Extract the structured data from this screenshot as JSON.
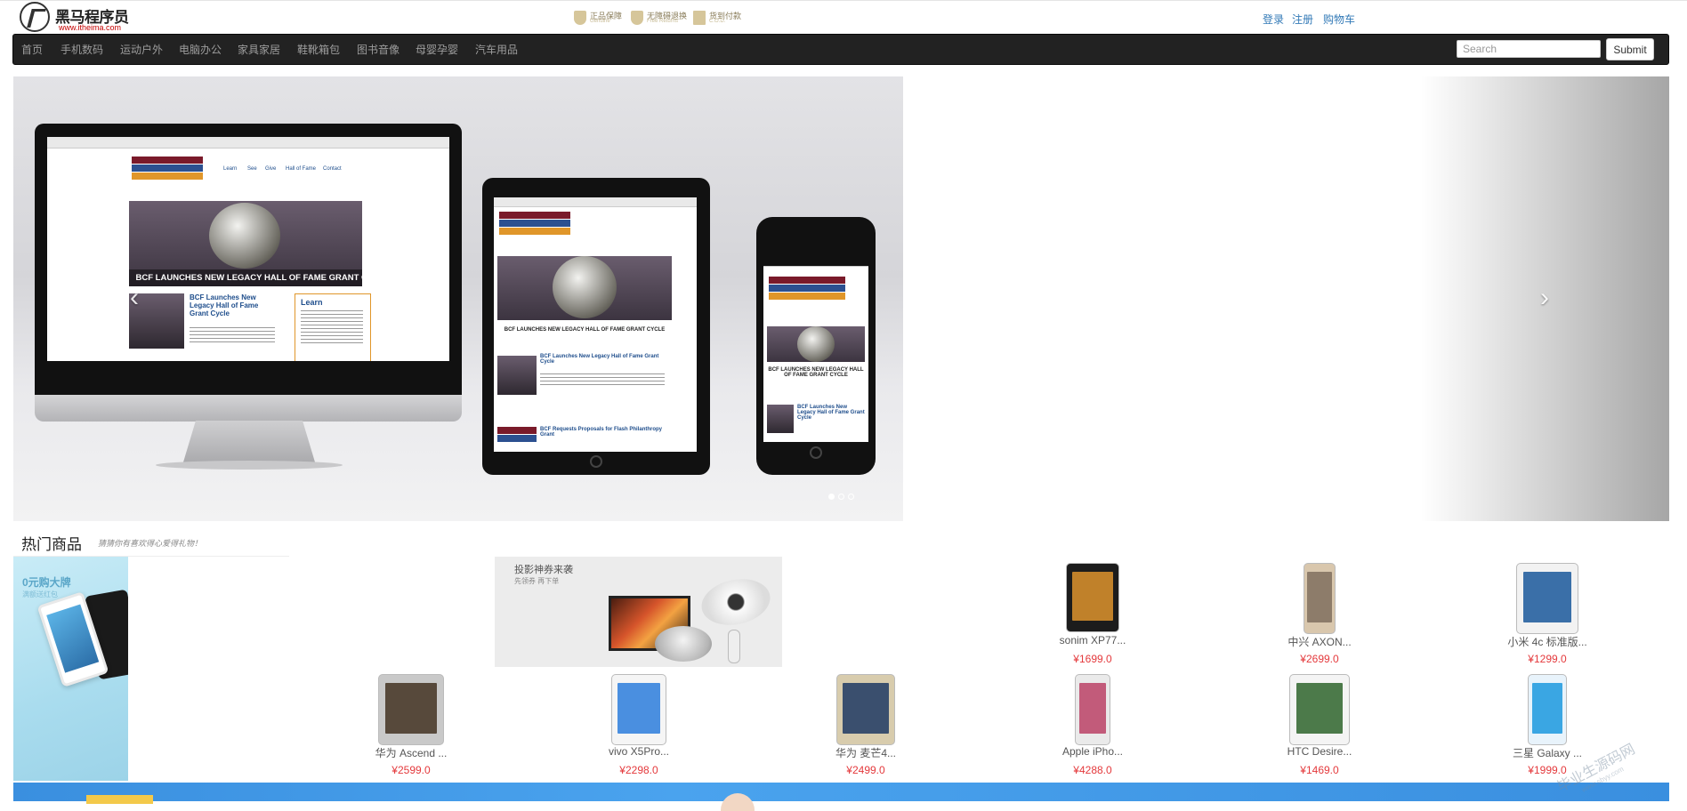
{
  "header": {
    "logo_title": "黑马程序员",
    "logo_url": "www.itheima.com",
    "badges": [
      {
        "title": "正品保障",
        "sub": "Genuine"
      },
      {
        "title": "无障碍退换",
        "sub": "Free Returns"
      },
      {
        "title": "货到付款",
        "sub": "C.O.D."
      }
    ],
    "user_links": [
      "登录",
      "注册",
      "购物车"
    ]
  },
  "navbar": {
    "items": [
      "首页",
      "手机数码",
      "运动户外",
      "电脑办公",
      "家具家居",
      "鞋靴箱包",
      "图书音像",
      "母婴孕婴",
      "汽车用品"
    ],
    "search_placeholder": "Search",
    "submit_label": "Submit"
  },
  "carousel": {
    "prev_icon": "‹",
    "next_icon": "›",
    "indicator_count": 3,
    "active_index": 0,
    "slide_text": {
      "desktop_headline": "BCF LAUNCHES NEW LEGACY HALL OF FAME GRANT CYCLE",
      "desktop_article": "BCF Launches New Legacy Hall of Fame Grant Cycle",
      "desktop_learn": "Learn",
      "desktop_nav": [
        "Learn",
        "See",
        "Give",
        "Hall of Fame",
        "Contact"
      ],
      "tablet_headline": "BCF LAUNCHES NEW LEGACY HALL OF FAME GRANT CYCLE",
      "tablet_article": "BCF Launches New Legacy Hall of Fame Grant Cycle",
      "tablet_article2": "BCF Requests Proposals for Flash Philanthropy Grant",
      "phone_headline": "BCF LAUNCHES NEW LEGACY HALL OF FAME GRANT CYCLE",
      "phone_article": "BCF Launches New Legacy Hall of Fame Grant Cycle"
    }
  },
  "hot": {
    "title": "热门商品",
    "subtitle": "猜猜你有喜欢得心爱得礼物！",
    "promo_left_title": "0元购大牌",
    "promo_left_sub": "满额送红包",
    "promo_mid_title": "投影神券来袭",
    "promo_mid_sub": "先领券 再下单"
  },
  "products": [
    {
      "name": "sonim XP77...",
      "price": "¥1699.0",
      "body": "#1c1c1c",
      "screen": "#c0812a"
    },
    {
      "name": "中兴 AXON...",
      "price": "¥2699.0",
      "body": "#d9c7ad",
      "screen": "#8d7c6a"
    },
    {
      "name": "小米 4c 标准版...",
      "price": "¥1299.0",
      "body": "#f2f2f2",
      "screen": "#3a6fa8"
    },
    {
      "name": "华为 Ascend ...",
      "price": "¥2599.0",
      "body": "#c9c9c9",
      "screen": "#57493b"
    },
    {
      "name": "vivo X5Pro...",
      "price": "¥2298.0",
      "body": "#f5f5f5",
      "screen": "#4a8fe0"
    },
    {
      "name": "华为 麦芒4...",
      "price": "¥2499.0",
      "body": "#d8ccad",
      "screen": "#3a4f6e"
    },
    {
      "name": "Apple iPho...",
      "price": "¥4288.0",
      "body": "#eaeaea",
      "screen": "#c25b7a"
    },
    {
      "name": "HTC Desire...",
      "price": "¥1469.0",
      "body": "#f4f4f4",
      "screen": "#4c7a4a"
    },
    {
      "name": "三星 Galaxy ...",
      "price": "¥1999.0",
      "body": "#e8f3fb",
      "screen": "#3aa6e3"
    }
  ],
  "watermark": {
    "text": "毕业生源码网",
    "sub": "www.sbyy.com"
  }
}
